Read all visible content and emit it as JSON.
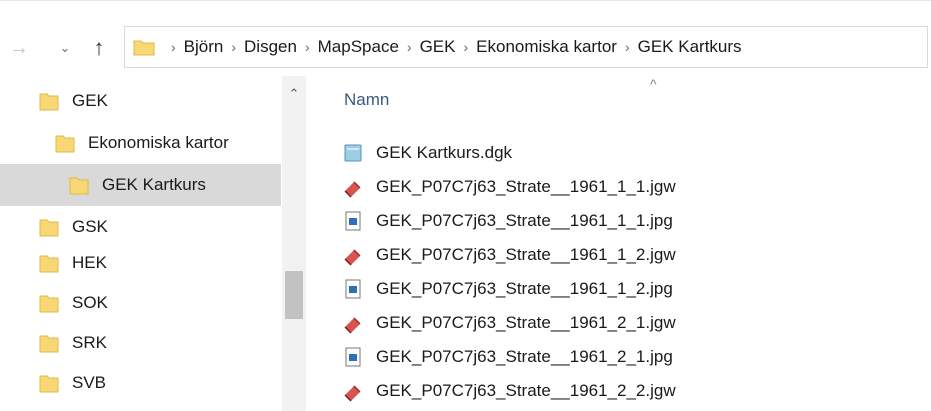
{
  "nav": {
    "back_icon": "back-arrow-icon",
    "recent_icon": "chevron-down-icon",
    "up_icon": "up-arrow-icon"
  },
  "address_bar": {
    "folder_icon": "folder-icon",
    "breadcrumbs": [
      "Björn",
      "Disgen",
      "MapSpace",
      "GEK",
      "Ekonomiska kartor",
      "GEK Kartkurs"
    ]
  },
  "sidebar": {
    "items": [
      {
        "label": "GEK",
        "level": 0,
        "selected": false
      },
      {
        "label": "Ekonomiska kartor",
        "level": 1,
        "selected": false
      },
      {
        "label": "GEK Kartkurs",
        "level": 2,
        "selected": true
      },
      {
        "label": "GSK",
        "level": 0,
        "selected": false
      },
      {
        "label": "HEK",
        "level": 0,
        "selected": false
      },
      {
        "label": "SOK",
        "level": 0,
        "selected": false
      },
      {
        "label": "SRK",
        "level": 0,
        "selected": false
      },
      {
        "label": "SVB",
        "level": 0,
        "selected": false
      }
    ]
  },
  "file_list": {
    "column_header": "Namn",
    "sort_indicator": "^",
    "files": [
      {
        "name": "GEK Kartkurs.dgk",
        "icon": "dgk-file-icon"
      },
      {
        "name": "GEK_P07C7j63_Strate__1961_1_1.jgw",
        "icon": "jgw-file-icon"
      },
      {
        "name": "GEK_P07C7j63_Strate__1961_1_1.jpg",
        "icon": "jpg-file-icon"
      },
      {
        "name": "GEK_P07C7j63_Strate__1961_1_2.jgw",
        "icon": "jgw-file-icon"
      },
      {
        "name": "GEK_P07C7j63_Strate__1961_1_2.jpg",
        "icon": "jpg-file-icon"
      },
      {
        "name": "GEK_P07C7j63_Strate__1961_2_1.jgw",
        "icon": "jgw-file-icon"
      },
      {
        "name": "GEK_P07C7j63_Strate__1961_2_1.jpg",
        "icon": "jpg-file-icon"
      },
      {
        "name": "GEK_P07C7j63_Strate__1961_2_2.jgw",
        "icon": "jgw-file-icon"
      }
    ]
  },
  "colors": {
    "folder": "#f8d775",
    "selected_bg": "#d9d9d9",
    "header_text": "#3a5a80"
  }
}
